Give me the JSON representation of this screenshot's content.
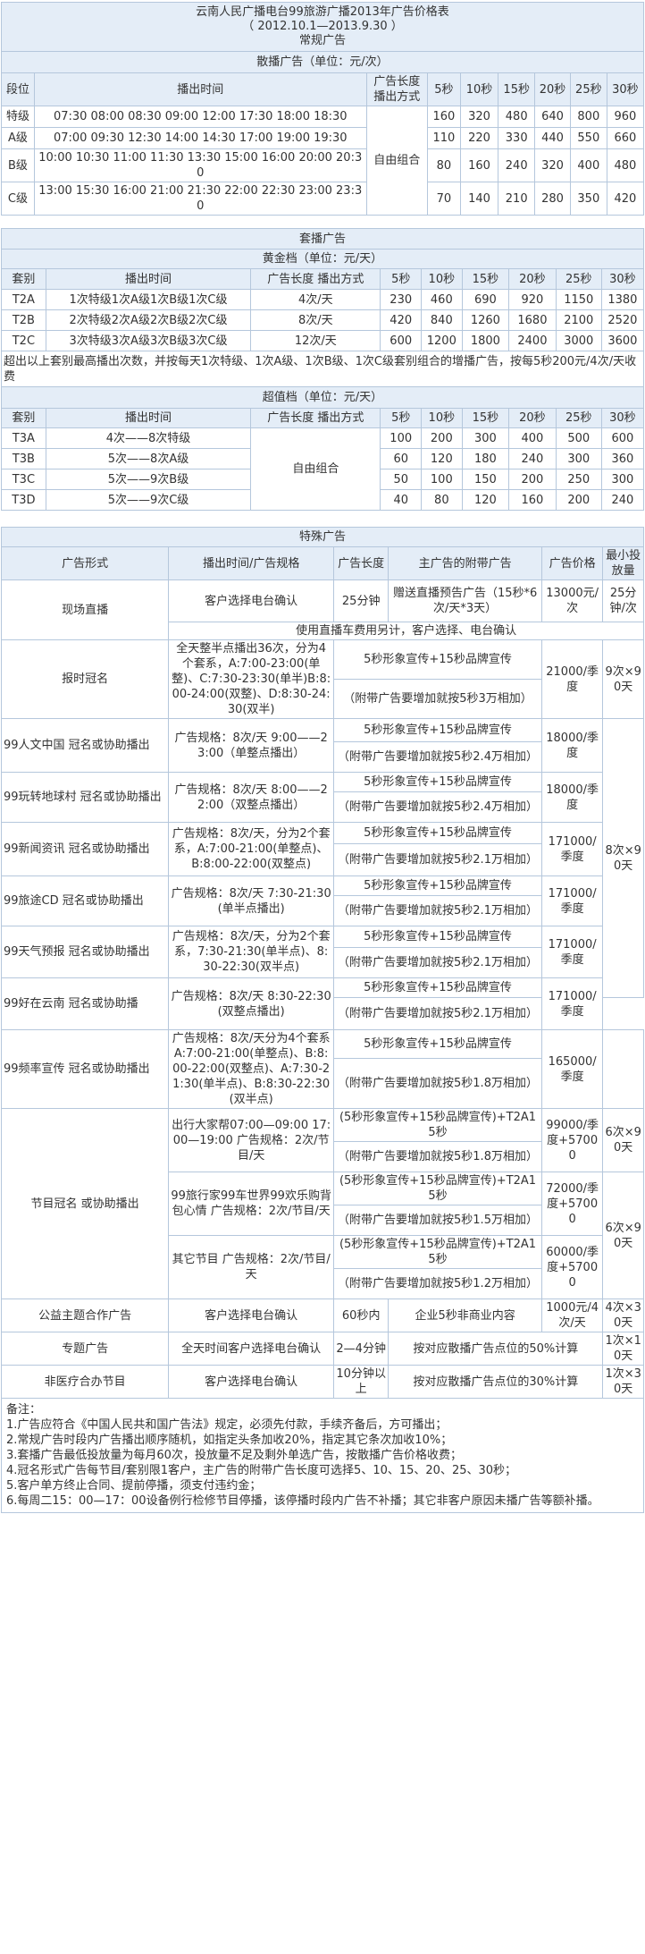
{
  "t1": {
    "title": "云南人民广播电台99旅游广播2013年广告价格表",
    "period": "（ 2012.10.1—2013.9.30 ）",
    "subtitle": "常规广告",
    "section": "散播广告（单位：元/次）",
    "headers": [
      "段位",
      "播出时间",
      "广告长度 播出方式",
      "5秒",
      "10秒",
      "15秒",
      "20秒",
      "25秒",
      "30秒"
    ],
    "mode": "自由组合",
    "rows": [
      {
        "level": "特级",
        "time": "07:30 08:00 08:30 09:00 12:00 17:30 18:00 18:30",
        "prices": [
          "160",
          "320",
          "480",
          "640",
          "800",
          "960"
        ]
      },
      {
        "level": "A级",
        "time": "07:00 09:30 12:30 14:00 14:30 17:00 19:00 19:30",
        "prices": [
          "110",
          "220",
          "330",
          "440",
          "550",
          "660"
        ]
      },
      {
        "level": "B级",
        "time": "10:00 10:30 11:00 11:30 13:30 15:00 16:00 20:00 20:30",
        "prices": [
          "80",
          "160",
          "240",
          "320",
          "400",
          "480"
        ]
      },
      {
        "level": "C级",
        "time": "13:00 15:30 16:00 21:00 21:30 22:00 22:30 23:00 23:30",
        "prices": [
          "70",
          "140",
          "210",
          "280",
          "350",
          "420"
        ]
      }
    ]
  },
  "t2": {
    "title": "套播广告",
    "gold": "黄金档（单位：元/天）",
    "headers": [
      "套别",
      "播出时间",
      "广告长度 播出方式",
      "5秒",
      "10秒",
      "15秒",
      "20秒",
      "25秒",
      "30秒"
    ],
    "gold_rows": [
      {
        "set": "T2A",
        "time": "1次特级1次A级1次B级1次C级",
        "mode": "4次/天",
        "prices": [
          "230",
          "460",
          "690",
          "920",
          "1150",
          "1380"
        ]
      },
      {
        "set": "T2B",
        "time": "2次特级2次A级2次B级2次C级",
        "mode": "8次/天",
        "prices": [
          "420",
          "840",
          "1260",
          "1680",
          "2100",
          "2520"
        ]
      },
      {
        "set": "T2C",
        "time": "3次特级3次A级3次B级3次C级",
        "mode": "12次/天",
        "prices": [
          "600",
          "1200",
          "1800",
          "2400",
          "3000",
          "3600"
        ]
      }
    ],
    "gold_note": "超出以上套别最高播出次数，并按每天1次特级、1次A级、1次B级、1次C级套别组合的增播广告，按每5秒200元/4次/天收费",
    "value": "超值档（单位：元/天）",
    "value_mode": "自由组合",
    "value_rows": [
      {
        "set": "T3A",
        "time": "4次——8次特级",
        "prices": [
          "100",
          "200",
          "300",
          "400",
          "500",
          "600"
        ]
      },
      {
        "set": "T3B",
        "time": "5次——8次A级",
        "prices": [
          "60",
          "120",
          "180",
          "240",
          "300",
          "360"
        ]
      },
      {
        "set": "T3C",
        "time": "5次——9次B级",
        "prices": [
          "50",
          "100",
          "150",
          "200",
          "250",
          "300"
        ]
      },
      {
        "set": "T3D",
        "time": "5次——9次C级",
        "prices": [
          "40",
          "80",
          "120",
          "160",
          "200",
          "240"
        ]
      }
    ]
  },
  "t3": {
    "title": "特殊广告",
    "headers": [
      "广告形式",
      "播出时间/广告规格",
      "广告长度",
      "主广告的附带广告",
      "广告价格",
      "最小投放量"
    ],
    "live": {
      "form": "现场直播",
      "time": "客户选择电台确认",
      "len": "25分钟",
      "extra": "赠送直播预告广告（15秒*6次/天*3天）",
      "price": "13000元/次",
      "min": "25分钟/次",
      "note": "使用直播车费用另计，客户选择、电台确认"
    },
    "std_a": "5秒形象宣传+15秒品牌宣传",
    "min_9x90": "9次×90天",
    "min_8x90": "8次×90天",
    "min_6x90": "6次×90天",
    "sponsor": [
      {
        "form": "报时冠名",
        "spec": "全天整半点播出36次，分为4个套系，A:7:00-23:00(单整)、C:7:30-23:30(单半)B:8:00-24:00(双整)、D:8:30-24:30(双半)",
        "b": "（附带广告要增加就按5秒3万相加）",
        "price": "21000/季度"
      },
      {
        "form": "99人文中国 冠名或协助播出",
        "spec": "广告规格：8次/天 9:00——23:00（单整点播出）",
        "b": "（附带广告要增加就按5秒2.4万相加）",
        "price": "18000/季度"
      },
      {
        "form": "99玩转地球村 冠名或协助播出",
        "spec": "广告规格：8次/天 8:00——22:00（双整点播出）",
        "b": "（附带广告要增加就按5秒2.4万相加）",
        "price": "18000/季度"
      },
      {
        "form": "99新闻资讯 冠名或协助播出",
        "spec": "广告规格：8次/天，分为2个套系，A:7:00-21:00(单整点)、B:8:00-22:00(双整点)",
        "b": "（附带广告要增加就按5秒2.1万相加）",
        "price": "171000/季度"
      },
      {
        "form": "99旅途CD 冠名或协助播出",
        "spec": "广告规格：8次/天 7:30-21:30(单半点播出)",
        "b": "（附带广告要增加就按5秒2.1万相加）",
        "price": "171000/季度"
      },
      {
        "form": "99天气预报 冠名或协助播出",
        "spec": "广告规格：8次/天，分为2个套系，7:30-21:30(单半点)、8:30-22:30(双半点)",
        "b": "（附带广告要增加就按5秒2.1万相加）",
        "price": "171000/季度"
      },
      {
        "form": "99好在云南 冠名或协助播",
        "spec": "广告规格：8次/天 8:30-22:30(双整点播出)",
        "b": "（附带广告要增加就按5秒2.1万相加）",
        "price": "171000/季度"
      },
      {
        "form": "99频率宣传 冠名或协助播出",
        "spec": "广告规格：8次/天分为4个套系A:7:00-21:00(单整点)、B:8:00-22:00(双整点)、A:7:30-21:30(单半点)、B:8:30-22:30(双半点)",
        "b": "（附带广告要增加就按5秒1.8万相加）",
        "price": "165000/季度"
      }
    ],
    "program": {
      "form": "节目冠名 或协助播出",
      "a": "(5秒形象宣传+15秒品牌宣传)+T2A15秒",
      "rows": [
        {
          "spec": "出行大家帮07:00—09:00 17:00—19:00 广告规格：2次/节目/天",
          "b": "（附带广告要增加就按5秒1.8万相加）",
          "price": "99000/季度+57000"
        },
        {
          "spec": "99旅行家99车世界99欢乐购背包心情 广告规格：2次/节目/天",
          "b": "（附带广告要增加就按5秒1.5万相加）",
          "price": "72000/季度+57000"
        },
        {
          "spec": "其它节目 广告规格：2次/节目/天",
          "b": "（附带广告要增加就按5秒1.2万相加）",
          "price": "60000/季度+57000"
        }
      ]
    },
    "others": [
      {
        "form": "公益主题合作广告",
        "time": "客户选择电台确认",
        "len": "60秒内",
        "extra": "企业5秒非商业内容",
        "price": "1000元/4次/天",
        "min": "4次×30天"
      },
      {
        "form": "专题广告",
        "time": "全天时间客户选择电台确认",
        "len": "2—4分钟",
        "extra": "按对应散播广告点位的50%计算",
        "min": "1次×10天"
      },
      {
        "form": "非医疗合办节目",
        "time": "客户选择电台确认",
        "len": "10分钟以上",
        "extra": "按对应散播广告点位的30%计算",
        "min": "1次×30天"
      }
    ]
  },
  "notes": {
    "title": "备注：",
    "items": [
      "1.广告应符合《中国人民共和国广告法》规定，必须先付款，手续齐备后，方可播出；",
      "2.常规广告时段内广告播出顺序随机，如指定头条加收20%，指定其它条次加收10%；",
      "3.套播广告最低投放量为每月60次，投放量不足及剩外单选广告，按散播广告价格收费；",
      "4.冠名形式广告每节目/套别限1客户，主广告的附带广告长度可选择5、10、15、20、25、30秒；",
      "5.客户单方终止合同、提前停播，须支付违约金；",
      "6.每周二15：00—17：00设备例行检修节目停播，该停播时段内广告不补播；其它非客户原因未播广告等额补播。"
    ]
  }
}
